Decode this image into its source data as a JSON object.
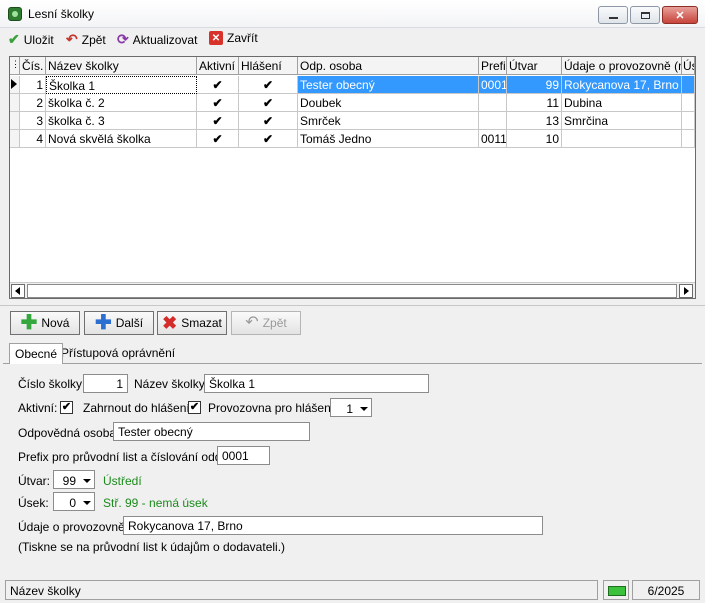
{
  "window": {
    "title": "Lesní školky"
  },
  "toolbar": {
    "save": "Uložit",
    "back": "Zpět",
    "refresh": "Aktualizovat",
    "close": "Zavřít"
  },
  "grid": {
    "columns": [
      "Čís.",
      "Název školky",
      "Aktivní",
      "Hlášení",
      "Odp. osoba",
      "Prefi",
      "Útvar",
      "Údaje o provozovně (na",
      "Ús"
    ],
    "rows": [
      {
        "cis": "1",
        "nazev": "Školka 1",
        "aktivni": "✔",
        "hlaseni": "✔",
        "osoba": "Tester obecný",
        "prefix": "0001",
        "utvar": "99",
        "udaje": "Rokycanova 17, Brno"
      },
      {
        "cis": "2",
        "nazev": "školka č. 2",
        "aktivni": "✔",
        "hlaseni": "✔",
        "osoba": "Doubek",
        "prefix": "",
        "utvar": "11",
        "udaje": "Dubina"
      },
      {
        "cis": "3",
        "nazev": "školka č. 3",
        "aktivni": "✔",
        "hlaseni": "✔",
        "osoba": "Smrček",
        "prefix": "",
        "utvar": "13",
        "udaje": "Smrčina"
      },
      {
        "cis": "4",
        "nazev": "Nová skvělá školka",
        "aktivni": "✔",
        "hlaseni": "✔",
        "osoba": "Tomáš Jedno",
        "prefix": "0011",
        "utvar": "10",
        "udaje": ""
      }
    ]
  },
  "actions": {
    "new": "Nová",
    "next": "Další",
    "delete": "Smazat",
    "undo": "Zpět"
  },
  "tabs": [
    "Obecné",
    "Přístupová oprávnění"
  ],
  "form": {
    "cislo_label": "Číslo školky:",
    "cislo_value": "1",
    "nazev_label": "Název školky:",
    "nazev_value": "Školka 1",
    "aktivni_label": "Aktivní:",
    "aktivni_check": "✔",
    "hlaseni_label": "Zahrnout do hlášení:",
    "hlaseni_check": "✔",
    "provozovna_label": "Provozovna pro hlášení:",
    "provozovna_value": "1",
    "osoba_label": "Odpovědná osoba:",
    "osoba_value": "Tester obecný",
    "prefix_label": "Prefix pro průvodní list a číslování oddílů:",
    "prefix_value": "0001",
    "utvar_label": "Útvar:",
    "utvar_value": "99",
    "utvar_desc": "Ústředí",
    "usek_label": "Úsek:",
    "usek_value": "0",
    "usek_desc": "Stř. 99 - nemá úsek",
    "udaje_label": "Údaje o provozovně:",
    "udaje_value": "Rokycanova 17, Brno",
    "note": "(Tiskne se na průvodní list k údajům o dodavateli.)"
  },
  "status": {
    "field": "Název školky",
    "page": "6/2025"
  },
  "colors": {
    "selection": "#3399ff",
    "green_text": "#1b8a1b"
  }
}
